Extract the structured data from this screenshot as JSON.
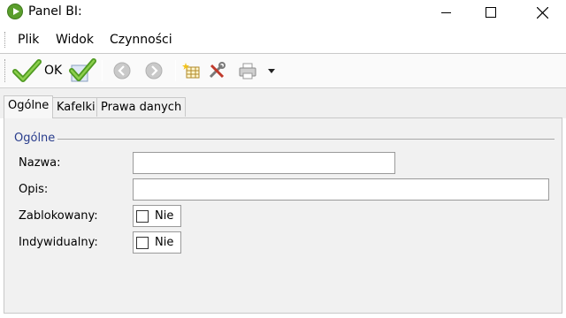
{
  "window": {
    "title": "Panel BI:"
  },
  "menu": {
    "items": [
      "Plik",
      "Widok",
      "Czynności"
    ]
  },
  "toolbar": {
    "ok_label": "OK"
  },
  "tabs": [
    "Ogólne",
    "Kafelki",
    "Prawa danych"
  ],
  "active_tab": "Ogólne",
  "group": {
    "title": "Ogólne"
  },
  "fields": {
    "nazwa": {
      "label": "Nazwa:",
      "value": ""
    },
    "opis": {
      "label": "Opis:",
      "value": ""
    },
    "zablokowany": {
      "label": "Zablokowany:",
      "text": "Nie",
      "checked": false
    },
    "indywidualny": {
      "label": "Indywidualny:",
      "text": "Nie",
      "checked": false
    }
  },
  "colors": {
    "accent_green": "#5a9e2c",
    "group_title": "#283c8c"
  }
}
